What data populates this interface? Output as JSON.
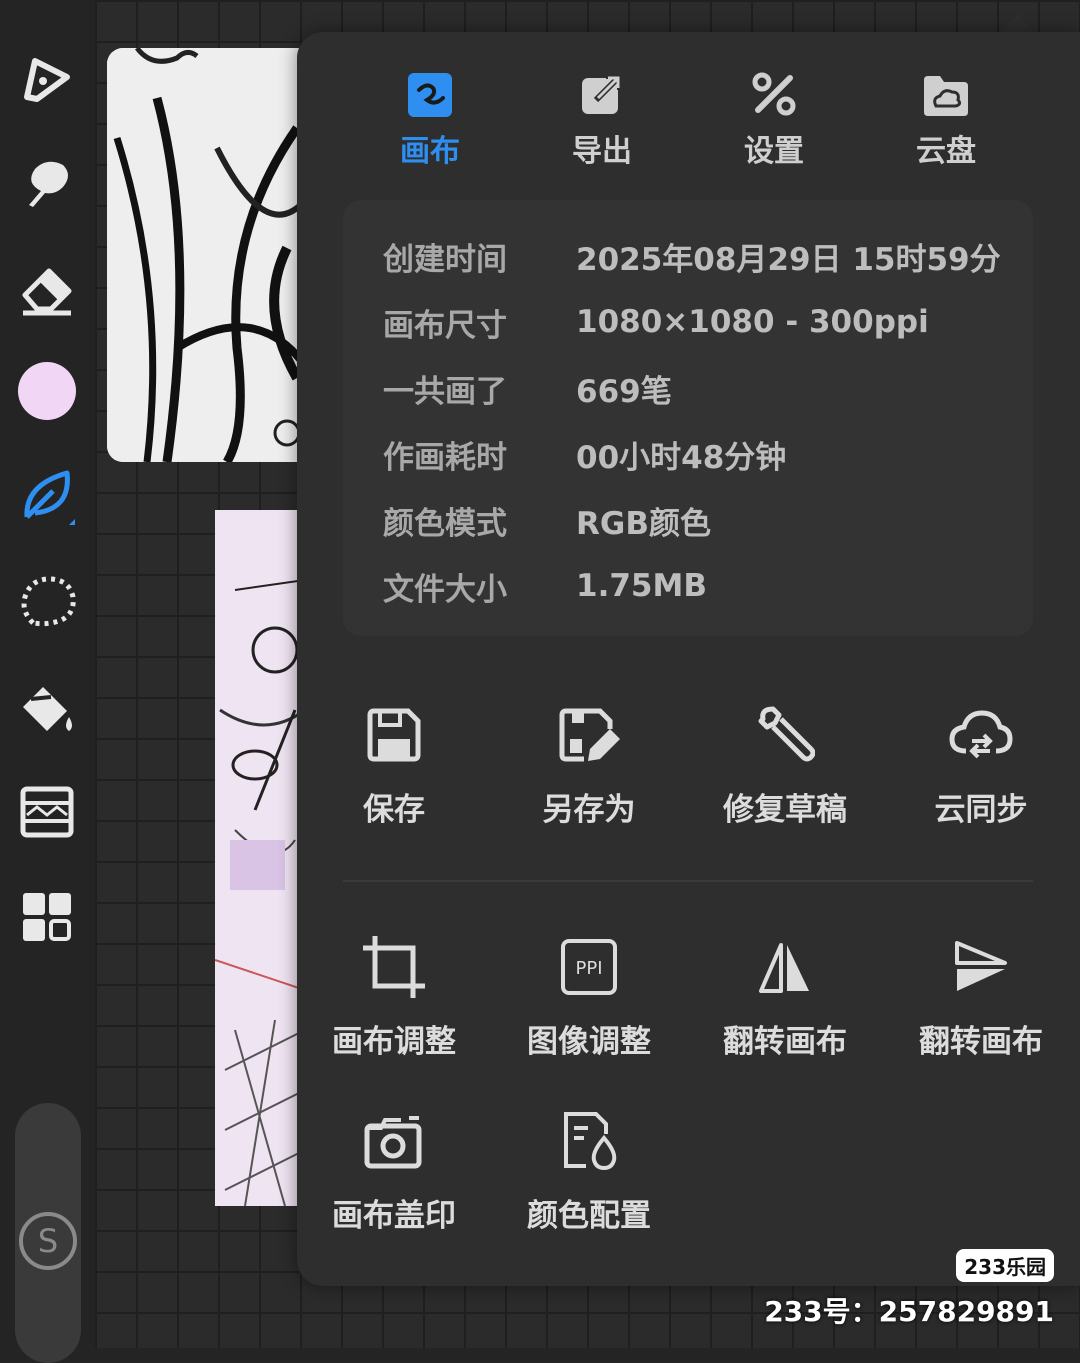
{
  "tabs": [
    {
      "label": "画布",
      "icon": "canvas-icon",
      "active": true
    },
    {
      "label": "导出",
      "icon": "export-icon",
      "active": false
    },
    {
      "label": "设置",
      "icon": "settings-icon",
      "active": false
    },
    {
      "label": "云盘",
      "icon": "cloud-drive-icon",
      "active": false
    }
  ],
  "info": [
    {
      "key": "创建时间",
      "value": "2025年08月29日 15时59分"
    },
    {
      "key": "画布尺寸",
      "value": "1080×1080 - 300ppi"
    },
    {
      "key": "一共画了",
      "value": "669笔"
    },
    {
      "key": "作画耗时",
      "value": "00小时48分钟"
    },
    {
      "key": "颜色模式",
      "value": "RGB颜色"
    },
    {
      "key": "文件大小",
      "value": "1.75MB"
    }
  ],
  "actions_row1": [
    {
      "label": "保存",
      "icon": "save-icon"
    },
    {
      "label": "另存为",
      "icon": "save-as-icon"
    },
    {
      "label": "修复草稿",
      "icon": "wrench-icon"
    },
    {
      "label": "云同步",
      "icon": "cloud-sync-icon"
    }
  ],
  "actions_row2": [
    {
      "label": "画布调整",
      "icon": "crop-icon"
    },
    {
      "label": "图像调整",
      "icon": "ppi-icon",
      "icon_text": "PPI"
    },
    {
      "label": "翻转画布",
      "icon": "flip-horizontal-icon"
    },
    {
      "label": "翻转画布",
      "icon": "flip-vertical-icon"
    }
  ],
  "actions_row3": [
    {
      "label": "画布盖印",
      "icon": "camera-icon"
    },
    {
      "label": "颜色配置",
      "icon": "color-profile-icon"
    }
  ],
  "toolbar": {
    "tools": [
      "pen-tool-icon",
      "smudge-icon",
      "eraser-icon",
      "color-swatch",
      "leaf-brush-icon",
      "lasso-icon",
      "bucket-icon",
      "layers-icon",
      "grid-icon"
    ],
    "current_color": "#f2d6f6",
    "s_logo_text": "S"
  },
  "colors": {
    "accent": "#2f8ff0",
    "panel": "#2e2e2e",
    "info_box": "#333333"
  },
  "watermark": {
    "logo": "233乐园",
    "text": "233号：257829891"
  }
}
